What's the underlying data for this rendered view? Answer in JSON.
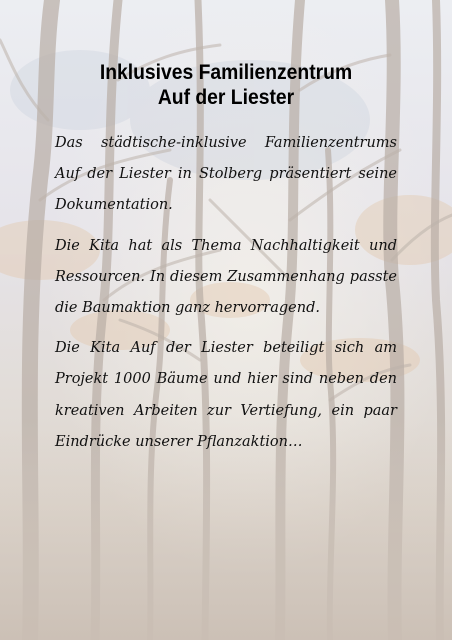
{
  "document": {
    "title_line1": "Inklusives Familienzentrum",
    "title_line2": "Auf der Liester",
    "paragraphs": [
      "Das städtische-inklusive Familienzentrums Auf der Liester in Stolberg präsentiert seine Dokumentation.",
      "Die Kita hat als Thema Nachhaltigkeit und Ressourcen. In diesem Zusammenhang passte die Baumaktion ganz hervorragend.",
      "Die Kita Auf der Liester beteiligt sich am Projekt 1000 Bäume und hier sind neben den kreativen Arbeiten zur Vertiefung, ein paar Eindrücke unserer Pflanzaktion…"
    ]
  },
  "background": {
    "subject": "faded-forest-photo",
    "sky_color": "#eceef2",
    "trunk_color": "#b9aea6",
    "foliage_color": "#e3c9b0"
  }
}
